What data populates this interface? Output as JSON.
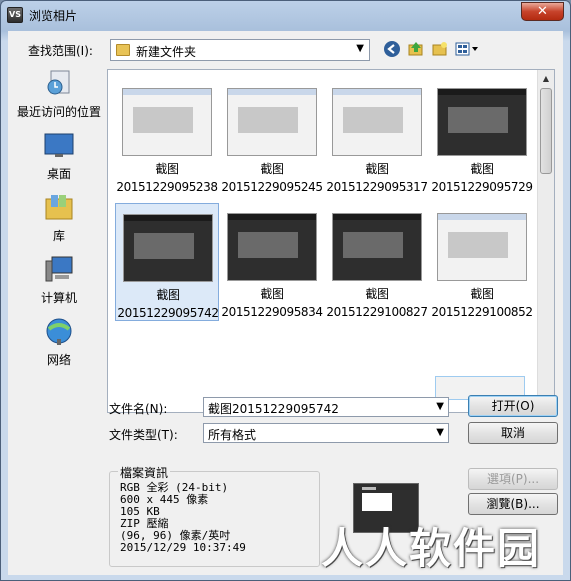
{
  "window": {
    "title": "浏览相片",
    "close_glyph": "✕",
    "app_icon_text": "VS"
  },
  "toolbar": {
    "look_in_label": "查找范围(I):",
    "look_in_value": "新建文件夹",
    "back_icon": "back-icon",
    "up_icon": "up-folder-icon",
    "new_folder_icon": "new-folder-icon",
    "views_icon": "views-menu-icon"
  },
  "places": [
    {
      "label": "最近访问的位置",
      "icon": "recent-places-icon"
    },
    {
      "label": "桌面",
      "icon": "desktop-icon"
    },
    {
      "label": "库",
      "icon": "libraries-icon"
    },
    {
      "label": "计算机",
      "icon": "computer-icon"
    },
    {
      "label": "网络",
      "icon": "network-icon"
    }
  ],
  "files": [
    {
      "name": "截图",
      "date": "20151229095238",
      "style": "light",
      "selected": false
    },
    {
      "name": "截图",
      "date": "20151229095245",
      "style": "light",
      "selected": false
    },
    {
      "name": "截图",
      "date": "20151229095317",
      "style": "light",
      "selected": false
    },
    {
      "name": "截图",
      "date": "20151229095729",
      "style": "dark",
      "selected": false
    },
    {
      "name": "截图",
      "date": "20151229095742",
      "style": "dark",
      "selected": true
    },
    {
      "name": "截图",
      "date": "20151229095834",
      "style": "dark",
      "selected": false
    },
    {
      "name": "截图",
      "date": "20151229100827",
      "style": "dark",
      "selected": false
    },
    {
      "name": "截图",
      "date": "20151229100852",
      "style": "light",
      "selected": false
    }
  ],
  "fields": {
    "filename_label": "文件名(N):",
    "filename_value": "截图20151229095742",
    "filetype_label": "文件类型(T):",
    "filetype_value": "所有格式"
  },
  "buttons": {
    "open": "打开(O)",
    "cancel": "取消",
    "options": "選項(P)...",
    "browse": "瀏覽(B)..."
  },
  "file_info": {
    "title": "檔案資訊",
    "lines": [
      "RGB 全彩 (24-bit)",
      "600 x 445 像素",
      "105 KB",
      "ZIP 壓縮",
      "(96, 96) 像素/英吋",
      "2015/12/29  10:37:49"
    ]
  },
  "watermark": "人人软件园"
}
